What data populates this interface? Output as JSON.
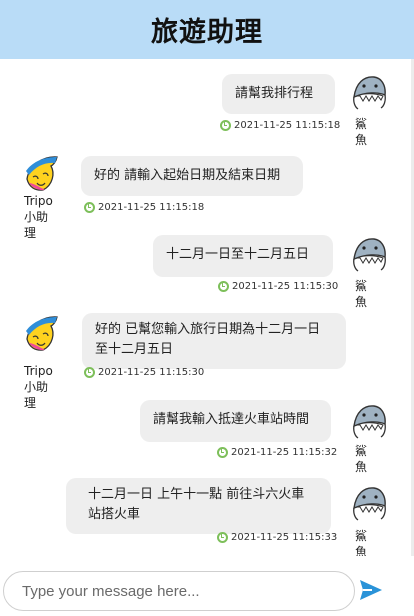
{
  "header": {
    "title": "旅遊助理"
  },
  "user": {
    "name": "鯊魚"
  },
  "bot": {
    "name_line1": "Tripo",
    "name_line2": "小助理"
  },
  "messages": [
    {
      "from": "user",
      "text": "請幫我排行程",
      "time": "2021-11-25 11:15:18"
    },
    {
      "from": "bot",
      "text": "好的 請輸入起始日期及結束日期",
      "time": "2021-11-25 11:15:18"
    },
    {
      "from": "user",
      "text": "十二月一日至十二月五日",
      "time": "2021-11-25 11:15:30"
    },
    {
      "from": "bot",
      "text_line1": "好的 已幫您輸入旅行日期為十二月一日",
      "text_line2": "至十二月五日",
      "time": "2021-11-25 11:15:30"
    },
    {
      "from": "user",
      "text": "請幫我輸入抵達火車站時間",
      "time": "2021-11-25 11:15:32"
    },
    {
      "from": "user",
      "text_line1": "十二月一日 上午十一點 前往斗六火車",
      "text_line2": "站搭火車",
      "time": "2021-11-25 11:15:33"
    }
  ],
  "composer": {
    "placeholder": "Type your message here..."
  },
  "colors": {
    "header_bg": "#b9dcf7",
    "bubble_bg": "#eeeeee",
    "clock": "#7dbf5a",
    "send": "#2a93d8"
  },
  "icons": {
    "user_avatar": "shark-icon",
    "bot_avatar": "banana-mascot-icon",
    "send": "send-icon",
    "timestamp": "clock-icon"
  }
}
